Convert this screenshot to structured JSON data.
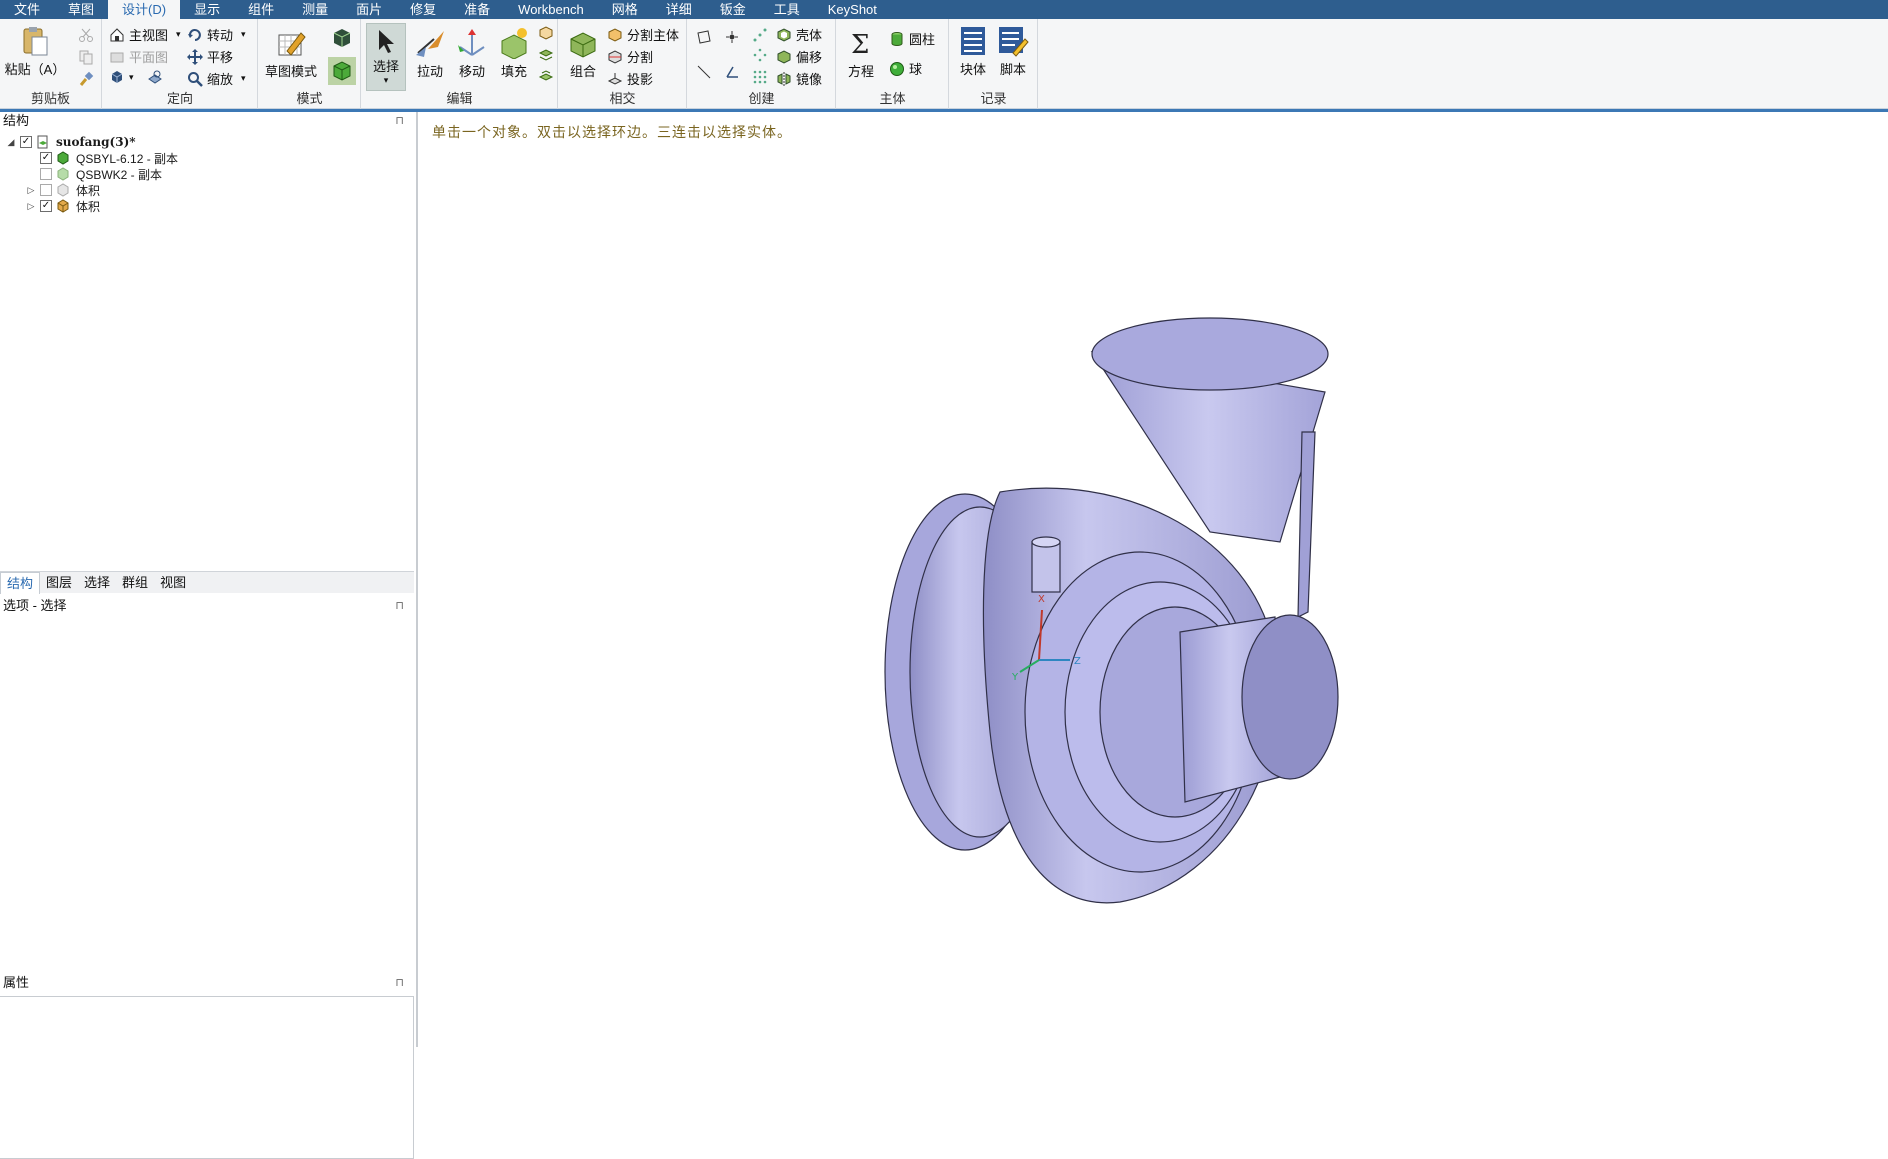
{
  "menu": {
    "tabs": [
      {
        "label": "文件"
      },
      {
        "label": "草图"
      },
      {
        "label": "设计(D)",
        "active": true
      },
      {
        "label": "显示"
      },
      {
        "label": "组件"
      },
      {
        "label": "测量"
      },
      {
        "label": "面片"
      },
      {
        "label": "修复"
      },
      {
        "label": "准备"
      },
      {
        "label": "Workbench"
      },
      {
        "label": "网格"
      },
      {
        "label": "详细"
      },
      {
        "label": "钣金"
      },
      {
        "label": "工具"
      },
      {
        "label": "KeyShot"
      }
    ]
  },
  "ribbon": {
    "clipboard": {
      "paste": "粘贴（A）",
      "group": "剪贴板"
    },
    "orient": {
      "home": "主视图",
      "plan": "平面图",
      "spin": "转动",
      "pan": "平移",
      "zoom": "缩放",
      "group": "定向"
    },
    "mode": {
      "sketch_mode": "草图模式",
      "group": "模式"
    },
    "edit": {
      "select": "选择",
      "pull": "拉动",
      "move": "移动",
      "fill": "填充",
      "group": "编辑"
    },
    "intersect": {
      "combine": "组合",
      "split_body": "分割主体",
      "split": "分割",
      "project": "投影",
      "group": "相交"
    },
    "create": {
      "shell": "壳体",
      "offset": "偏移",
      "mirror": "镜像",
      "group": "创建"
    },
    "body": {
      "equation": "方程",
      "cylinder": "圆柱",
      "sphere": "球",
      "group": "主体"
    },
    "record": {
      "block": "块体",
      "script": "脚本",
      "group": "记录"
    }
  },
  "structure": {
    "header": "结构",
    "tree": [
      {
        "label": "suofang(3)*",
        "checked": true,
        "expanded": true,
        "root": true
      },
      {
        "label": "QSBYL-6.12 - 副本",
        "checked": true
      },
      {
        "label": "QSBWK2 - 副本",
        "checked": false
      },
      {
        "label": "体积",
        "checked": false,
        "collapsed": true
      },
      {
        "label": "体积",
        "checked": true,
        "collapsed": true
      }
    ]
  },
  "panel_tabs": [
    "结构",
    "图层",
    "选择",
    "群组",
    "视图"
  ],
  "options": {
    "header": "选项 - 选择"
  },
  "properties": {
    "header": "属性"
  },
  "viewport": {
    "hint": "单击一个对象。双击以选择环边。三连击以选择实体。",
    "triad": {
      "x": "X",
      "y": "Y",
      "z": "Z"
    }
  },
  "colors": {
    "menubar": "#2e5e8e",
    "accent_rule": "#3c78b5",
    "model_fill": "#b9b9e3",
    "hint_text": "#7a6520"
  }
}
